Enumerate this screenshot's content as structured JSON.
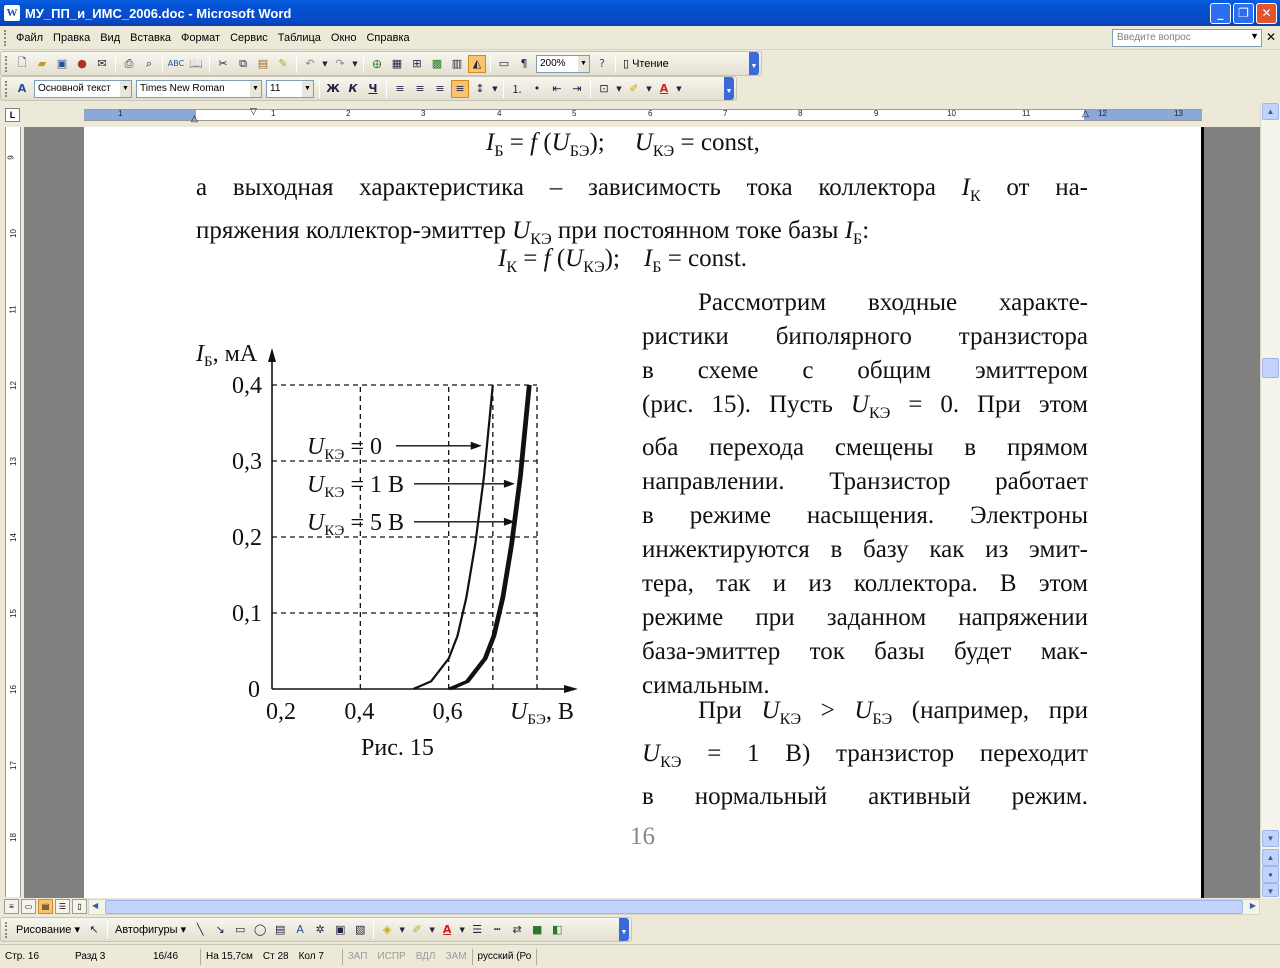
{
  "window": {
    "title": "МУ_ПП_и_ИМС_2006.doc - Microsoft Word",
    "app_icon": "W"
  },
  "menu": [
    "Файл",
    "Правка",
    "Вид",
    "Вставка",
    "Формат",
    "Сервис",
    "Таблица",
    "Окно",
    "Справка"
  ],
  "help": {
    "placeholder": "Введите вопрос"
  },
  "toolbar": {
    "zoom": "200%",
    "reading_label": "Чтение",
    "style": "Основной текст",
    "font": "Times New Roman",
    "size": "11",
    "bold": "Ж",
    "italic": "К",
    "underline": "Ч",
    "pilcrow": "¶"
  },
  "ruler": {
    "h_numbers": [
      "1",
      "1",
      "2",
      "3",
      "4",
      "5",
      "6",
      "7",
      "8",
      "9",
      "10",
      "11",
      "12",
      "13"
    ],
    "v_numbers": [
      "9",
      "10",
      "11",
      "12",
      "13",
      "14",
      "15",
      "16",
      "17",
      "18"
    ]
  },
  "document": {
    "formula1": {
      "a": "I",
      "a_sub": "Б",
      "mid": " = ",
      "f": "f",
      "open": " (",
      "b": "U",
      "b_sub": "БЭ",
      "close": ");",
      "c": "U",
      "c_sub": "КЭ",
      "rest": " = const,"
    },
    "para1": {
      "l1a": "а выходная характеристика – зависимость тока коллектора ",
      "l1i": "I",
      "l1s": "К",
      "l1b": " от на-",
      "l2a": "пряжения коллектор-эмиттер ",
      "l2i": "U",
      "l2s": "КЭ",
      "l2b": " при постоянном токе базы ",
      "l2i2": "I",
      "l2s2": "Б",
      "l2c": ":"
    },
    "formula2": {
      "a": "I",
      "a_sub": "К",
      "mid": " = ",
      "f": "f",
      "open": " (",
      "b": "U",
      "b_sub": "КЭ",
      "close": ");",
      "c": "I",
      "c_sub": "Б",
      "rest": " = const."
    },
    "para2": {
      "lines": [
        "Рассмотрим входные характе-",
        "ристики биполярного транзистора",
        "в схеме с общим эмиттером",
        "(рис. 15). Пусть ",
        "оба перехода смещены в прямом",
        "направлении. Транзистор работает",
        "в режиме насыщения. Электроны",
        "инжектируются в базу как из эмит-",
        "тера, так и из коллектора. В этом",
        "режиме при заданном напряжении",
        "база-эмиттер ток базы будет мак-",
        "симальным."
      ],
      "l4_var": "U",
      "l4_sub": "КЭ",
      "l4_rest": " = 0. При этом"
    },
    "para3": {
      "l1a": "При ",
      "l1v1": "U",
      "l1s1": "КЭ",
      "l1gt": " > ",
      "l1v2": "U",
      "l1s2": "БЭ",
      "l1b": " (например, при",
      "l2v": "U",
      "l2s": "КЭ",
      "l2b": " = 1 В) транзистор переходит",
      "l3": "в нормальный активный режим."
    },
    "caption": "Рис. 15",
    "page_number": "16"
  },
  "chart_data": {
    "type": "line",
    "title": "",
    "ylabel": "I",
    "ylabel_sub": "Б",
    "ylabel_unit": ", мА",
    "xlabel": "U",
    "xlabel_sub": "БЭ",
    "xlabel_unit": ", В",
    "xlim": [
      0.2,
      0.8
    ],
    "ylim": [
      0,
      0.4
    ],
    "x_ticks": [
      "0,2",
      "0,4",
      "0,6"
    ],
    "y_ticks": [
      "0",
      "0,1",
      "0,2",
      "0,3",
      "0,4"
    ],
    "grid": true,
    "series": [
      {
        "name": "UКЭ = 0",
        "label_var": "U",
        "label_sub": "КЭ",
        "label_val": " = 0",
        "x": [
          0.52,
          0.56,
          0.6,
          0.62,
          0.64,
          0.66,
          0.68,
          0.7
        ],
        "y": [
          0,
          0.01,
          0.04,
          0.07,
          0.12,
          0.19,
          0.28,
          0.4
        ]
      },
      {
        "name": "UКЭ = 1 В",
        "label_var": "U",
        "label_sub": "КЭ",
        "label_val": " = 1 В",
        "x": [
          0.6,
          0.64,
          0.68,
          0.7,
          0.72,
          0.74,
          0.76,
          0.78
        ],
        "y": [
          0,
          0.01,
          0.04,
          0.07,
          0.12,
          0.19,
          0.28,
          0.4
        ]
      },
      {
        "name": "UКЭ = 5 В",
        "label_var": "U",
        "label_sub": "КЭ",
        "label_val": " = 5 В",
        "x": [
          0.605,
          0.645,
          0.685,
          0.705,
          0.725,
          0.745,
          0.765,
          0.785
        ],
        "y": [
          0,
          0.01,
          0.04,
          0.07,
          0.12,
          0.19,
          0.28,
          0.4
        ]
      }
    ]
  },
  "drawing_toolbar": {
    "draw_label": "Рисование",
    "autoshapes_label": "Автофигуры"
  },
  "status": {
    "page": "Стр. 16",
    "section": "Разд 3",
    "pages": "16/46",
    "at": "На 15,7см",
    "line": "Ст 28",
    "col": "Кол 7",
    "rec": "ЗАП",
    "trk": "ИСПР",
    "ext": "ВДЛ",
    "ovr": "ЗАМ",
    "lang": "русский (Ро"
  }
}
